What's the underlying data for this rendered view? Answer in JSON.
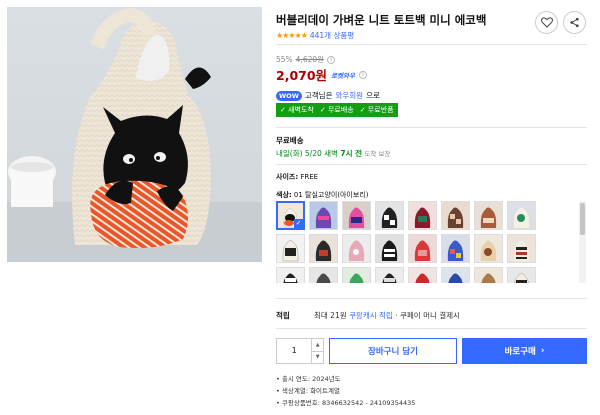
{
  "product": {
    "title": "버블리데이 가벼운 니트 토트백 미니 에코백",
    "stars": "★★★★★",
    "review_count": "441개 상품평"
  },
  "price": {
    "discount_rate": "55%",
    "original_price": "4,620원",
    "sale_price": "2,070원",
    "rocket_badge": "로켓와우"
  },
  "wow": {
    "badge": "WOW",
    "prefix": "고객님은",
    "link": "와우회원",
    "suffix": "으로",
    "benefits": [
      "✓ 새벽도착",
      "✓ 무료배송",
      "✓ 무료반품"
    ]
  },
  "shipping": {
    "title": "무료배송",
    "date_prefix": "내일(화) 5/20 새벽",
    "date_time": "7시 전",
    "date_suffix": "도착 보장"
  },
  "options": {
    "size_label": "사이즈:",
    "size_value": "FREE",
    "color_label": "색상:",
    "color_value": "01 탈실고양이(아이보리)"
  },
  "points": {
    "label": "적립",
    "prefix": "최대 21원",
    "link": "쿠팡캐시 적립",
    "suffix": "· 쿠페이 머니 결제시"
  },
  "purchase": {
    "quantity": "1",
    "cart_label": "장바구니 담기",
    "buy_label": "바로구매"
  },
  "details": [
    "출시 연도: 2024년도",
    "색상계열: 화이트계열",
    "쿠팡상품번호: 8346632542 - 24109354435"
  ],
  "colors": {
    "accent": "#346aff",
    "price": "#ae0000",
    "benefit": "#12a012",
    "star": "#ff9900"
  }
}
